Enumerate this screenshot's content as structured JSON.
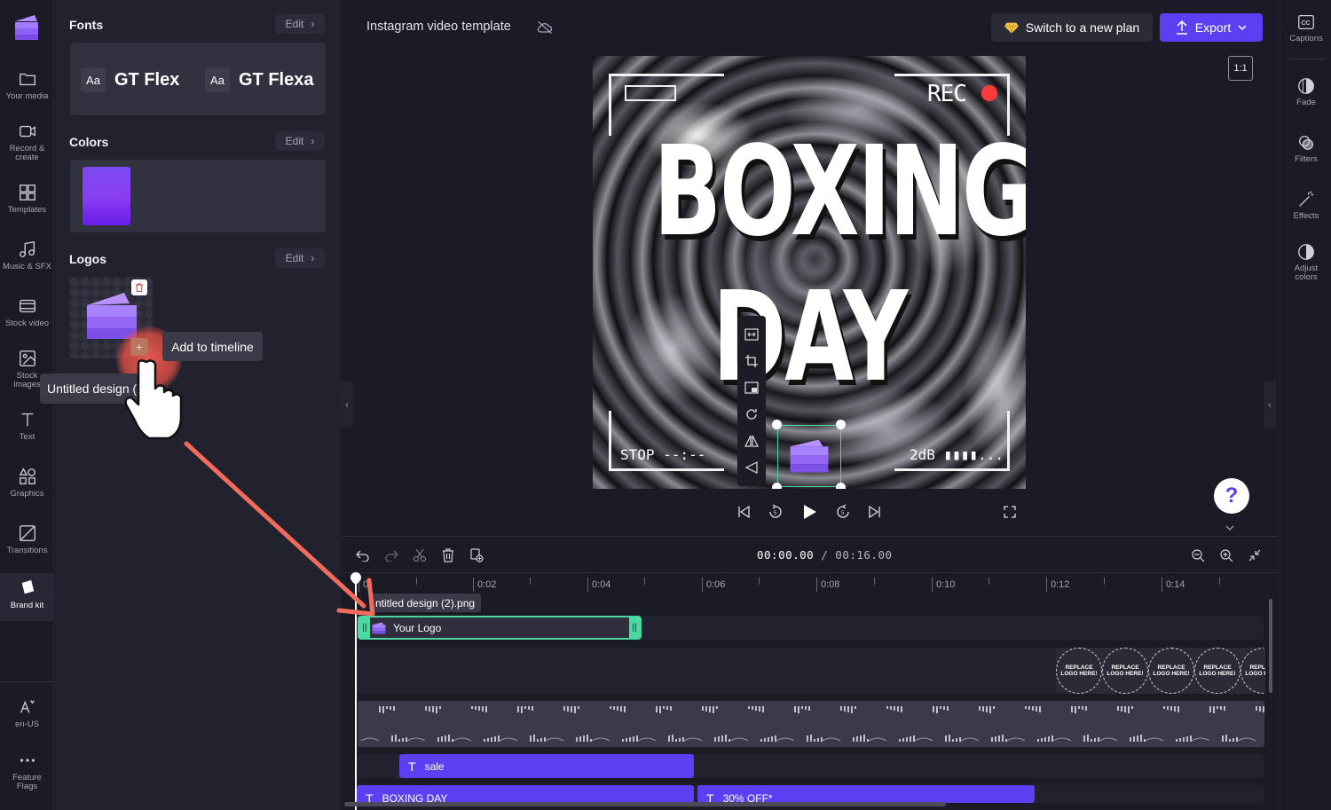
{
  "left_rail": {
    "items": [
      {
        "label": "Your media",
        "icon": "folder-icon"
      },
      {
        "label": "Record & create",
        "icon": "camera-icon"
      },
      {
        "label": "Templates",
        "icon": "templates-icon"
      },
      {
        "label": "Music & SFX",
        "icon": "music-icon"
      },
      {
        "label": "Stock video",
        "icon": "film-icon"
      },
      {
        "label": "Stock images",
        "icon": "image-icon"
      },
      {
        "label": "Text",
        "icon": "text-icon"
      },
      {
        "label": "Graphics",
        "icon": "shapes-icon"
      },
      {
        "label": "Transitions",
        "icon": "transitions-icon"
      },
      {
        "label": "Brand kit",
        "icon": "brand-kit-icon",
        "active": true
      }
    ],
    "bottom": [
      {
        "label": "en-US",
        "icon": "language-icon"
      },
      {
        "label": "Feature Flags",
        "icon": "more-icon"
      }
    ]
  },
  "brand_panel": {
    "fonts": {
      "title": "Fonts",
      "edit": "Edit",
      "chips": [
        {
          "aa": "Aa",
          "name": "GT Flex"
        },
        {
          "aa": "Aa",
          "name": "GT Flexa"
        }
      ]
    },
    "colors": {
      "title": "Colors",
      "edit": "Edit",
      "swatch": "#7b3cf0"
    },
    "logos": {
      "title": "Logos",
      "edit": "Edit",
      "add_tooltip": "Add to timeline",
      "name_tooltip": "Untitled design (2"
    }
  },
  "topbar": {
    "project_title": "Instagram video template",
    "plan_button": "Switch to a new plan",
    "export_button": "Export",
    "aspect_ratio": "1:1"
  },
  "canvas": {
    "line1": "BOXING",
    "line2": "DAY",
    "rec": "REC",
    "stop": "STOP --:--",
    "db": "2dB ▮▮▮▮..."
  },
  "right_rail": {
    "items": [
      {
        "label": "Captions",
        "icon": "captions-icon"
      },
      {
        "label": "Fade",
        "icon": "fade-icon"
      },
      {
        "label": "Filters",
        "icon": "filters-icon"
      },
      {
        "label": "Effects",
        "icon": "effects-icon"
      },
      {
        "label": "Adjust colors",
        "icon": "adjust-colors-icon"
      }
    ]
  },
  "timeline": {
    "current": "00:00.00",
    "total": "/ 00:16.00",
    "ticks": [
      "0",
      "0:02",
      "0:04",
      "0:06",
      "0:08",
      "0:10",
      "0:12",
      "0:14"
    ],
    "clip_label": "ntitled design (2).png",
    "logo_clip": "Your Logo",
    "replace_text": "REPLACE LOGO HERE!",
    "text_clips": {
      "sale": "sale",
      "boxing": "BOXING DAY",
      "off": "30% OFF*"
    }
  },
  "colors": {
    "accent": "#5b3ff3",
    "selection": "#4ad9a0",
    "rec": "#ff3b3b"
  }
}
